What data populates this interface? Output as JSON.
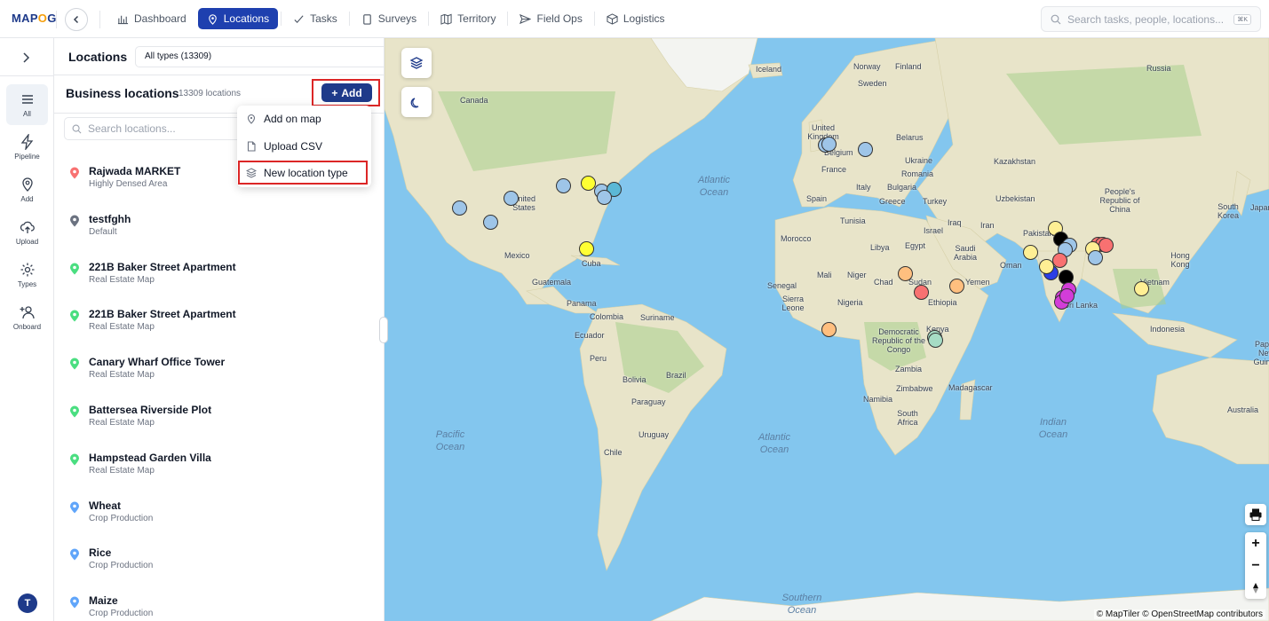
{
  "app": {
    "logo_text": "MAPOG",
    "search_placeholder": "Search tasks, people, locations...",
    "search_shortcut": "⌘K"
  },
  "nav": [
    {
      "label": "Dashboard",
      "icon": "bar-chart-icon",
      "active": false
    },
    {
      "label": "Locations",
      "icon": "map-pin-icon",
      "active": true
    },
    {
      "label": "Tasks",
      "icon": "check-icon",
      "active": false
    },
    {
      "label": "Surveys",
      "icon": "clipboard-icon",
      "active": false
    },
    {
      "label": "Territory",
      "icon": "map-icon",
      "active": false
    },
    {
      "label": "Field Ops",
      "icon": "send-icon",
      "active": false
    },
    {
      "label": "Logistics",
      "icon": "box-icon",
      "active": false
    }
  ],
  "rail": [
    {
      "label": "All",
      "icon": "list-icon",
      "active": true
    },
    {
      "label": "Pipeline",
      "icon": "bolt-icon",
      "active": false
    },
    {
      "label": "Add",
      "icon": "pin-add-icon",
      "active": false
    },
    {
      "label": "Upload",
      "icon": "cloud-upload-icon",
      "active": false
    },
    {
      "label": "Types",
      "icon": "gear-icon",
      "active": false
    },
    {
      "label": "Onboard",
      "icon": "user-add-icon",
      "active": false
    }
  ],
  "user_initial": "T",
  "panel": {
    "title": "Locations",
    "type_filter": "All types (13309)",
    "business_title": "Business locations",
    "business_count": "13309 locations",
    "add_label": "Add",
    "search_placeholder": "Search locations..."
  },
  "dropdown": [
    {
      "label": "Add on map",
      "icon": "pin-icon"
    },
    {
      "label": "Upload CSV",
      "icon": "file-icon"
    },
    {
      "label": "New location type",
      "icon": "layers-icon"
    }
  ],
  "locations": [
    {
      "name": "Rajwada MARKET",
      "type": "Highly Densed Area",
      "color": "#f87171"
    },
    {
      "name": "testfghh",
      "type": "Default",
      "color": "#6b7280"
    },
    {
      "name": "221B Baker Street Apartment",
      "type": "Real Estate Map",
      "color": "#4ade80"
    },
    {
      "name": "221B Baker Street Apartment",
      "type": "Real Estate Map",
      "color": "#4ade80"
    },
    {
      "name": "Canary Wharf Office Tower",
      "type": "Real Estate Map",
      "color": "#4ade80"
    },
    {
      "name": "Battersea Riverside Plot",
      "type": "Real Estate Map",
      "color": "#4ade80"
    },
    {
      "name": "Hampstead Garden Villa",
      "type": "Real Estate Map",
      "color": "#4ade80"
    },
    {
      "name": "Wheat",
      "type": "Crop Production",
      "color": "#60a5fa"
    },
    {
      "name": "Rice",
      "type": "Crop Production",
      "color": "#60a5fa"
    },
    {
      "name": "Maize",
      "type": "Crop Production",
      "color": "#60a5fa"
    }
  ],
  "map": {
    "labels": [
      "Iceland",
      "Norway",
      "Finland",
      "Sweden",
      "Russia",
      "Canada",
      "United Kingdom",
      "Belgium",
      "Belarus",
      "Ukraine",
      "France",
      "Romania",
      "Kazakhstan",
      "Spain",
      "Italy",
      "Bulgaria",
      "Uzbekistan",
      "People's Republic of China",
      "South Korea",
      "Japan",
      "Greece",
      "Turkey",
      "United States",
      "Tunisia",
      "Iraq",
      "Iran",
      "Israel",
      "Morocco",
      "Libya",
      "Egypt",
      "Saudi Arabia",
      "Pakistan",
      "Mexico",
      "Cuba",
      "Oman",
      "Hong Kong",
      "Mali",
      "Niger",
      "Chad",
      "Sudan",
      "Yemen",
      "Guatemala",
      "Senegal",
      "Sierra Leone",
      "Nigeria",
      "Ethiopia",
      "Vietnam",
      "Panama",
      "Colombia",
      "Suriname",
      "Ecuador",
      "Democratic Republic of the Congo",
      "Kenya",
      "Sri Lanka",
      "Indonesia",
      "Peru",
      "Brazil",
      "Zambia",
      "Bolivia",
      "Paraguay",
      "Zimbabwe",
      "Madagascar",
      "Namibia",
      "South Africa",
      "Uruguay",
      "Chile",
      "Australia",
      "Papua New Guinea"
    ],
    "oceans": [
      "Atlantic Ocean",
      "Pacific Ocean",
      "Atlantic Ocean",
      "Indian Ocean",
      "Southern Ocean"
    ],
    "attribution": "© MapTiler © OpenStreetMap contributors"
  }
}
